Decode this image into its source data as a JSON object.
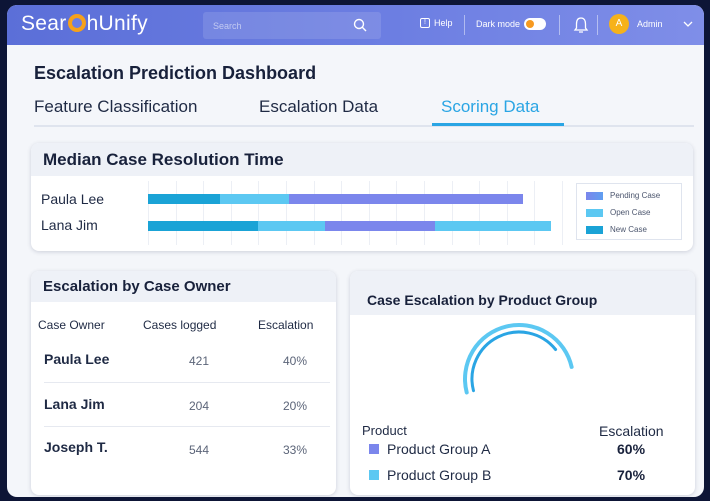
{
  "app": {
    "logo_text_1": "Sear",
    "logo_text_2": "hUnify"
  },
  "topbar": {
    "search_placeholder": "Search",
    "help_label": "Help",
    "dark_mode_label": "Dark mode",
    "dark_mode_on": true,
    "user_initial": "A",
    "user_name": "Admin"
  },
  "page": {
    "title": "Escalation Prediction Dashboard"
  },
  "tabs": [
    {
      "label": "Feature Classification",
      "active": false
    },
    {
      "label": "Escalation Data",
      "active": false
    },
    {
      "label": "Scoring Data",
      "active": true
    }
  ],
  "median_card": {
    "title": "Median Case Resolution Time",
    "legend": [
      {
        "label": "Pending Case",
        "color": "#7b86ec"
      },
      {
        "label": "Open Case",
        "color": "#5cc8f2"
      },
      {
        "label": "New Case",
        "color": "#1aa3d6"
      }
    ],
    "rows": [
      {
        "name": "Paula Lee"
      },
      {
        "name": "Lana Jim"
      }
    ]
  },
  "chart_data": {
    "type": "bar",
    "orientation": "horizontal",
    "stacked": true,
    "title": "Median Case Resolution Time",
    "categories": [
      "Paula Lee",
      "Lana Jim"
    ],
    "series": [
      {
        "name": "New Case",
        "color": "#1aa3d6",
        "values": [
          2.6,
          4.0
        ]
      },
      {
        "name": "Open Case",
        "color": "#5cc8f2",
        "values": [
          2.5,
          2.4
        ]
      },
      {
        "name": "Pending Case",
        "color": "#7b86ec",
        "values": [
          8.5,
          4.0
        ]
      },
      {
        "name": "Open Case (tail)",
        "color": "#5cc8f2",
        "values": [
          0,
          4.2
        ]
      }
    ],
    "xlim": [
      0,
      15
    ],
    "grid": true,
    "legend_position": "right"
  },
  "owner_card": {
    "title": "Escalation by Case Owner",
    "columns": [
      "Case Owner",
      "Cases logged",
      "Escalation"
    ],
    "rows": [
      {
        "owner": "Paula Lee",
        "cases": "421",
        "escalation": "40%"
      },
      {
        "owner": "Lana Jim",
        "cases": "204",
        "escalation": "20%"
      },
      {
        "owner": "Joseph T.",
        "cases": "544",
        "escalation": "33%"
      }
    ]
  },
  "product_card": {
    "title": "Case Escalation by Product Group",
    "header_product": "Product",
    "header_escalation": "Escalation",
    "rows": [
      {
        "name": "Product Group A",
        "value": "60%",
        "color": "#7b86ec"
      },
      {
        "name": "Product Group B",
        "value": "70%",
        "color": "#5cc8f2"
      }
    ],
    "gauge_values": [
      0.6,
      0.7
    ]
  }
}
